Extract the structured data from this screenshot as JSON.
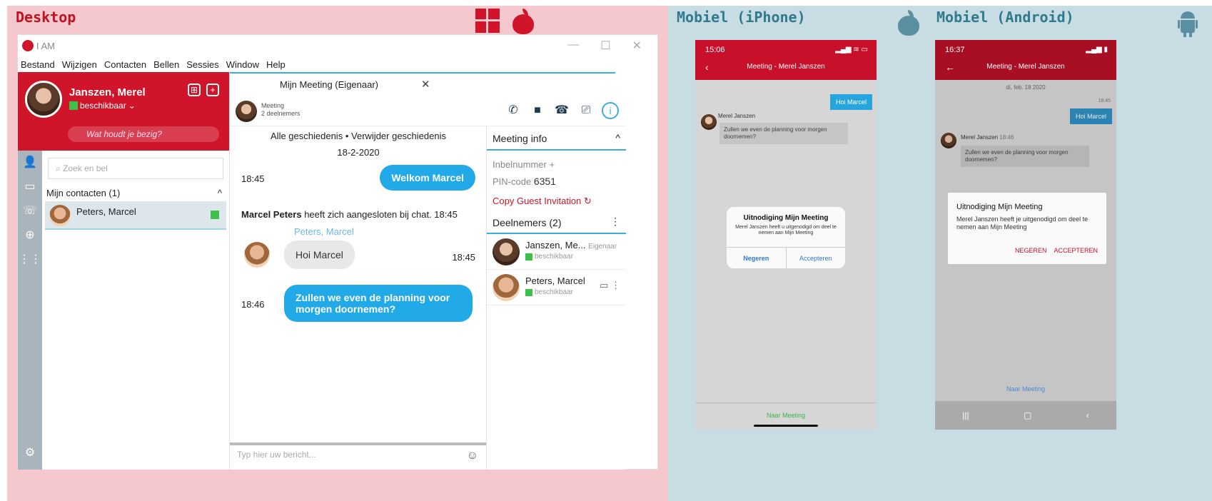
{
  "panels": {
    "desktop_title": "Desktop",
    "iphone_title": "Mobiel (iPhone)",
    "android_title": "Mobiel (Android)"
  },
  "app": {
    "name": "I AM",
    "menu": [
      "Bestand",
      "Wijzigen",
      "Contacten",
      "Bellen",
      "Sessies",
      "Window",
      "Help"
    ]
  },
  "profile": {
    "name": "Janszen, Merel",
    "status": "beschikbaar",
    "mood_placeholder": "Wat houdt je bezig?"
  },
  "contacts": {
    "search_placeholder": "Zoek en bel",
    "group_label": "Mijn contacten (1)",
    "items": [
      {
        "name": "Peters, Marcel"
      }
    ]
  },
  "chat": {
    "tab_label": "Mijn Meeting (Eigenaar)",
    "header_type": "Meeting",
    "header_count": "2 deelnemers",
    "history_all": "Alle geschiedenis",
    "history_sep": "•",
    "history_delete": "Verwijder geschiedenis",
    "date": "18-2-2020",
    "msg1_time": "18:45",
    "msg1_text": "Welkom Marcel",
    "joined_name": "Marcel Peters",
    "joined_text": "heeft zich aangesloten bij chat. 18:45",
    "msg2_sender": "Peters, Marcel",
    "msg2_text": "Hoi Marcel",
    "msg2_time": "18:45",
    "msg3_time": "18:46",
    "msg3_text": "Zullen we even de planning voor morgen doornemen?",
    "composer_placeholder": "Typ hier uw bericht..."
  },
  "info": {
    "title": "Meeting info",
    "inbel_label": "Inbelnummer +",
    "pin_label": "PIN-code",
    "pin_value": "6351",
    "copy_label": "Copy Guest Invitation",
    "participants_label": "Deelnemers (2)",
    "members": [
      {
        "name": "Janszen, Me...",
        "role": "Eigenaar",
        "status": "beschikbaar"
      },
      {
        "name": "Peters, Marcel",
        "role": "",
        "status": "beschikbaar"
      }
    ]
  },
  "iphone": {
    "time": "15:06",
    "title": "Meeting - Merel Janszen",
    "msg_out": "Hoi Marcel",
    "sender": "Merel Janszen",
    "msg_in": "Zullen we even de planning voor morgen doornemen?",
    "dialog_title": "Uitnodiging Mijn Meeting",
    "dialog_text": "Merel Janszen heeft u uitgenodigd om deel te nemen aan Mijn Meeting",
    "btn_ignore": "Negeren",
    "btn_accept": "Accepteren",
    "footer": "Naar Meeting"
  },
  "android": {
    "time": "16:37",
    "title": "Meeting - Merel Janszen",
    "date": "di, feb. 18 2020",
    "msg_out_time": "18:45",
    "msg_out": "Hoi Marcel",
    "sender": "Merel Janszen",
    "sender_time": "18:46",
    "msg_in": "Zullen we even de planning voor morgen doornemen?",
    "dialog_title": "Uitnodiging Mijn Meeting",
    "dialog_text": "Merel Janszen heeft je uitgenodigd om deel te nemen aan Mijn Meeting",
    "btn_ignore": "NEGEREN",
    "btn_accept": "ACCEPTEREN",
    "footer": "Naar Meeting"
  },
  "colors": {
    "brand_red": "#d0152a",
    "accent_blue": "#22a9e8",
    "online_green": "#3cc14b"
  }
}
